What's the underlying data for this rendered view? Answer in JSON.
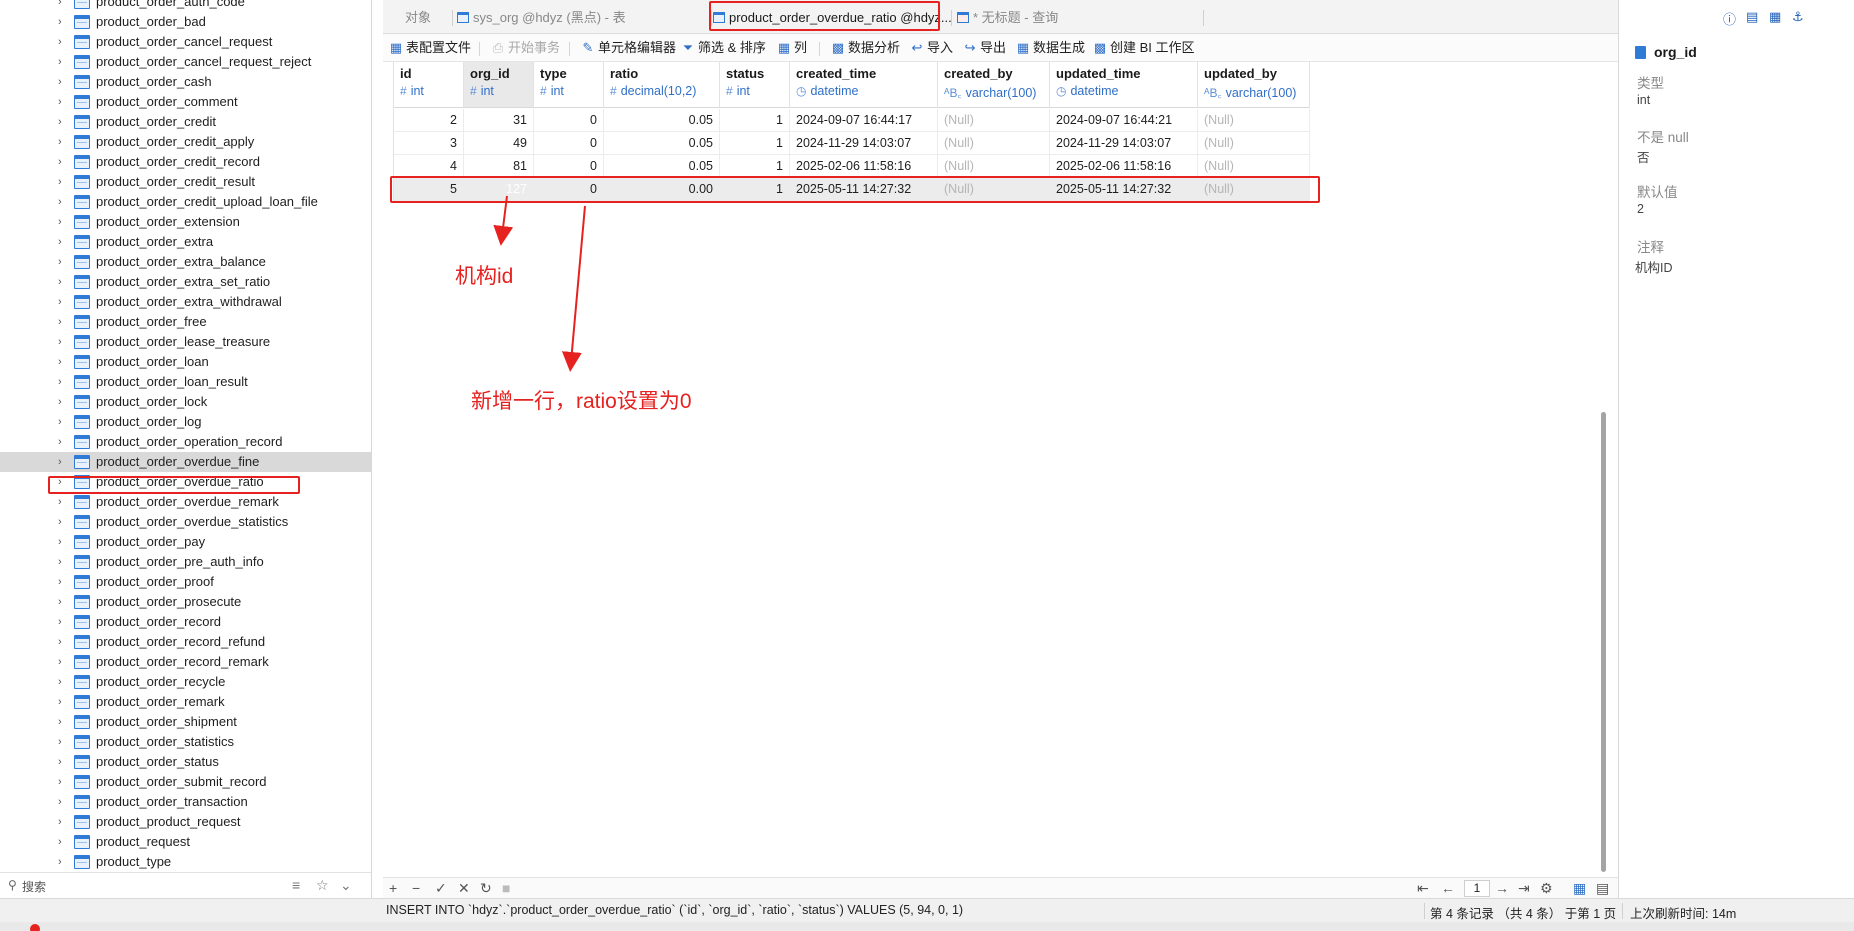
{
  "sidebar": {
    "items": [
      {
        "name": "product_order_auth_code"
      },
      {
        "name": "product_order_bad"
      },
      {
        "name": "product_order_cancel_request"
      },
      {
        "name": "product_order_cancel_request_reject"
      },
      {
        "name": "product_order_cash"
      },
      {
        "name": "product_order_comment"
      },
      {
        "name": "product_order_credit"
      },
      {
        "name": "product_order_credit_apply"
      },
      {
        "name": "product_order_credit_record"
      },
      {
        "name": "product_order_credit_result"
      },
      {
        "name": "product_order_credit_upload_loan_file"
      },
      {
        "name": "product_order_extension"
      },
      {
        "name": "product_order_extra"
      },
      {
        "name": "product_order_extra_balance"
      },
      {
        "name": "product_order_extra_set_ratio"
      },
      {
        "name": "product_order_extra_withdrawal"
      },
      {
        "name": "product_order_free"
      },
      {
        "name": "product_order_lease_treasure"
      },
      {
        "name": "product_order_loan"
      },
      {
        "name": "product_order_loan_result"
      },
      {
        "name": "product_order_lock"
      },
      {
        "name": "product_order_log"
      },
      {
        "name": "product_order_operation_record"
      },
      {
        "name": "product_order_overdue_fine"
      },
      {
        "name": "product_order_overdue_ratio"
      },
      {
        "name": "product_order_overdue_remark"
      },
      {
        "name": "product_order_overdue_statistics"
      },
      {
        "name": "product_order_pay"
      },
      {
        "name": "product_order_pre_auth_info"
      },
      {
        "name": "product_order_proof"
      },
      {
        "name": "product_order_prosecute"
      },
      {
        "name": "product_order_record"
      },
      {
        "name": "product_order_record_refund"
      },
      {
        "name": "product_order_record_remark"
      },
      {
        "name": "product_order_recycle"
      },
      {
        "name": "product_order_remark"
      },
      {
        "name": "product_order_shipment"
      },
      {
        "name": "product_order_statistics"
      },
      {
        "name": "product_order_status"
      },
      {
        "name": "product_order_submit_record"
      },
      {
        "name": "product_order_transaction"
      },
      {
        "name": "product_product_request"
      },
      {
        "name": "product_request"
      },
      {
        "name": "product_type"
      }
    ],
    "search_placeholder": "搜索"
  },
  "tabs": [
    {
      "label": "对象"
    },
    {
      "label": "sys_org @hdyz (黑点) - 表"
    },
    {
      "label": "product_order_overdue_ratio @hdyz..."
    },
    {
      "label": "* 无标题 - 查询"
    }
  ],
  "toolbar": {
    "items": [
      {
        "label": "表配置文件",
        "icon": "table-config-icon"
      },
      {
        "label": "开始事务",
        "icon": "transaction-icon"
      },
      {
        "label": "单元格编辑器",
        "icon": "cell-editor-icon"
      },
      {
        "label": "筛选 & 排序",
        "icon": "filter-icon"
      },
      {
        "label": "列",
        "icon": "columns-icon"
      },
      {
        "label": "数据分析",
        "icon": "analysis-icon"
      },
      {
        "label": "导入",
        "icon": "import-icon"
      },
      {
        "label": "导出",
        "icon": "export-icon"
      },
      {
        "label": "数据生成",
        "icon": "generate-icon"
      },
      {
        "label": "创建 BI 工作区",
        "icon": "bi-icon"
      }
    ]
  },
  "grid": {
    "columns": [
      {
        "name": "id",
        "type": "int",
        "glyph": "#"
      },
      {
        "name": "org_id",
        "type": "int",
        "glyph": "#"
      },
      {
        "name": "type",
        "type": "int",
        "glyph": "#"
      },
      {
        "name": "ratio",
        "type": "decimal(10,2)",
        "glyph": "#"
      },
      {
        "name": "status",
        "type": "int",
        "glyph": "#"
      },
      {
        "name": "created_time",
        "type": "datetime",
        "glyph": "◷"
      },
      {
        "name": "created_by",
        "type": "varchar(100)",
        "glyph": "ᴬB꜀"
      },
      {
        "name": "updated_time",
        "type": "datetime",
        "glyph": "◷"
      },
      {
        "name": "updated_by",
        "type": "varchar(100)",
        "glyph": "ᴬB꜀"
      }
    ],
    "rows": [
      [
        "2",
        "31",
        "0",
        "0.05",
        "1",
        "2024-09-07 16:44:17",
        "(Null)",
        "2024-09-07 16:44:21",
        "(Null)"
      ],
      [
        "3",
        "49",
        "0",
        "0.05",
        "1",
        "2024-11-29 14:03:07",
        "(Null)",
        "2024-11-29 14:03:07",
        "(Null)"
      ],
      [
        "4",
        "81",
        "0",
        "0.05",
        "1",
        "2025-02-06 11:58:16",
        "(Null)",
        "2025-02-06 11:58:16",
        "(Null)"
      ],
      [
        "5",
        "127",
        "0",
        "0.00",
        "1",
        "2025-05-11 14:27:32",
        "(Null)",
        "2025-05-11 14:27:32",
        "(Null)"
      ]
    ]
  },
  "annotations": {
    "org_id_note": "机构id",
    "new_row_note": "新增一行，ratio设置为0"
  },
  "gridbar": {
    "page": "1"
  },
  "statusbar": {
    "sql": "INSERT INTO `hdyz`.`product_order_overdue_ratio` (`id`, `org_id`, `ratio`, `status`) VALUES (5, 94, 0, 1)",
    "records": "第 4 条记录 （共 4 条） 于第 1 页",
    "refresh": "上次刷新时间: 14m"
  },
  "props": {
    "title": "org_id",
    "fields": [
      {
        "label": "类型",
        "value": "int"
      },
      {
        "label": "不是 null",
        "value": "否"
      },
      {
        "label": "默认值",
        "value": "2"
      },
      {
        "label": "注释",
        "value": "机构ID"
      }
    ]
  },
  "colors": {
    "accent": "#1769cc",
    "annotation": "#e5221f"
  }
}
